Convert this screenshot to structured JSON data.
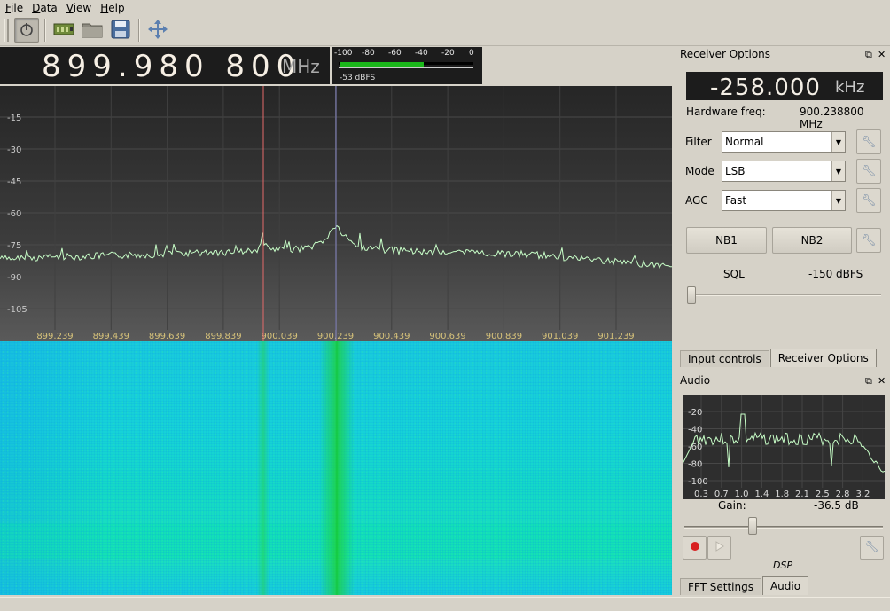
{
  "menubar": {
    "items": [
      {
        "label": "File",
        "accel": "F",
        "rest": "ile"
      },
      {
        "label": "Data",
        "accel": "D",
        "rest": "ata"
      },
      {
        "label": "View",
        "accel": "V",
        "rest": "iew"
      },
      {
        "label": "Help",
        "accel": "H",
        "rest": "elp"
      }
    ]
  },
  "toolbar": {
    "icons": [
      "power-icon",
      "sdr-device-icon",
      "open-folder-icon",
      "save-icon",
      "move-arrows-icon"
    ]
  },
  "frequency": {
    "digits": "899.980 800",
    "unit": "MHz"
  },
  "meter": {
    "ticks": [
      "-100",
      "-80",
      "-60",
      "-40",
      "-20",
      "0"
    ],
    "readout": "-53 dBFS",
    "level_dbfs": -53
  },
  "plotter": {
    "y_labels": [
      "-15",
      "-30",
      "-45",
      "-60",
      "-75",
      "-90",
      "-105"
    ],
    "x_labels": [
      "899.239",
      "899.439",
      "899.639",
      "899.839",
      "900.039",
      "900.239",
      "900.439",
      "900.639",
      "900.839",
      "901.039",
      "901.239"
    ],
    "demod_color": "#e46a6a",
    "center_color": "#8a8ac8",
    "trace_color": "#c8ffc8"
  },
  "receiver_options": {
    "title": "Receiver Options",
    "offset_value": "-258.000",
    "offset_unit": "kHz",
    "hw_label": "Hardware freq:",
    "hw_value": "900.238800 MHz",
    "filter_label": "Filter",
    "filter_value": "Normal",
    "mode_label": "Mode",
    "mode_value": "LSB",
    "agc_label": "AGC",
    "agc_value": "Fast",
    "nb1": "NB1",
    "nb2": "NB2",
    "sql_label": "SQL",
    "sql_value": "-150 dBFS",
    "tabs": [
      "Input controls",
      "Receiver Options"
    ]
  },
  "audio": {
    "title": "Audio",
    "y_labels": [
      "-20",
      "-40",
      "-60",
      "-80",
      "-100"
    ],
    "x_labels": [
      "0.3",
      "0.7",
      "1.0",
      "1.4",
      "1.8",
      "2.1",
      "2.5",
      "2.8",
      "3.2"
    ],
    "gain_label": "Gain:",
    "gain_value": "-36.5 dB",
    "dsp_label": "DSP",
    "tabs": [
      "FFT Settings",
      "Audio"
    ]
  }
}
